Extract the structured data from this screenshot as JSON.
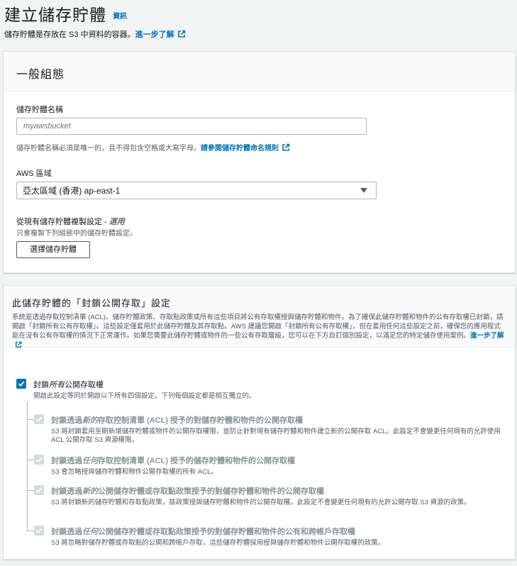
{
  "header": {
    "title": "建立儲存貯體",
    "info": "資訊",
    "subtitle": "儲存貯體是存放在 S3 中資料的容器。",
    "learn_more": "進一步了解"
  },
  "general": {
    "heading": "一般組態",
    "name_label": "儲存貯體名稱",
    "name_placeholder": "myawsbucket",
    "name_hint": "儲存貯體名稱必須是唯一的，且不得包含空格或大寫字母。",
    "name_rules_link": "請參閱儲存貯體命名規則",
    "region_label": "AWS 區域",
    "region_value": "亞太區域 (香港) ap-east-1",
    "copy_label": "從現有儲存貯體複製設定 - ",
    "copy_optional": "選用",
    "copy_hint": "只會複製下列組態中的儲存貯體設定。",
    "choose_button": "選擇儲存貯體"
  },
  "block": {
    "heading": "此儲存貯體的「封鎖公開存取」設定",
    "desc": "系統是透過存取控制清單 (ACL)、儲存貯體政策、存取點政策或所有這些項目將公有存取權授與儲存貯體和物件。為了確保此儲存貯體和物件的公有存取權已封鎖，請開啟「封鎖所有公有存取權」。這些設定僅套用於此儲存貯體及其存取點。AWS 建議您開啟「封鎖所有公有存取權」，但在套用任何這些設定之前，確保您的應用程式能在沒有公有存取權的情況下正常運作。如果您需要此儲存貯體或物件的一些公有存取層級，您可以在下方自訂個別設定，以滿足您的特定儲存使用案例。",
    "learn_more": "進一步了解",
    "all": {
      "title_a": "封鎖",
      "title_b": "所有",
      "title_c": "公開存取權",
      "desc": "開啟此設定等同於開啟以下所有四個設定。下列每個設定都是相互獨立的。",
      "checked": true
    },
    "options": [
      {
        "pre": "封鎖透過",
        "em": "新的",
        "post": "存取控制清單 (ACL) 授予的對儲存貯體和物件的公開存取權",
        "desc": "S3 將封鎖套用至剛新增儲存貯體或物件的公開存取權限，並防止針對現有儲存貯體和物件建立新的公開存取 ACL。此設定不會變更任何現有的允許使用 ACL 公開存取 S3 資源權限。"
      },
      {
        "pre": "封鎖透過",
        "em": "任何",
        "post": "存取控制清單 (ACL) 授予的儲存貯體和物件的公開存取權",
        "desc": "S3 會忽略授與儲存貯體和物件公開存取權的所有 ACL。"
      },
      {
        "pre": "封鎖透過",
        "em": "新的",
        "post": "公開儲存貯體或存取點政策授予的對儲存貯體和物件的公開存取權",
        "desc": "S3 將封鎖新的儲存貯體和存取點政策，該政策授與儲存貯體和物件的公開存取權。此設定不會變更任何現有的允許公開存取 S3 資源的政策。"
      },
      {
        "pre": "封鎖透過",
        "em": "任何",
        "post": "公開儲存貯體或存取點政策授予的對儲存貯體和物件的公有和跨帳戶存取權",
        "desc": "S3 將忽略對儲存貯體或存取點的公開和跨帳戶存取，這些儲存貯體採用授與儲存貯體和物件公開存取權的政策。"
      }
    ]
  },
  "colors": {
    "link": "#0073bb",
    "checkbox": "#0073bb",
    "disabled": "#d5dbdb"
  },
  "icons": [
    "external-link-icon",
    "caret-down-icon",
    "checkmark-icon"
  ]
}
